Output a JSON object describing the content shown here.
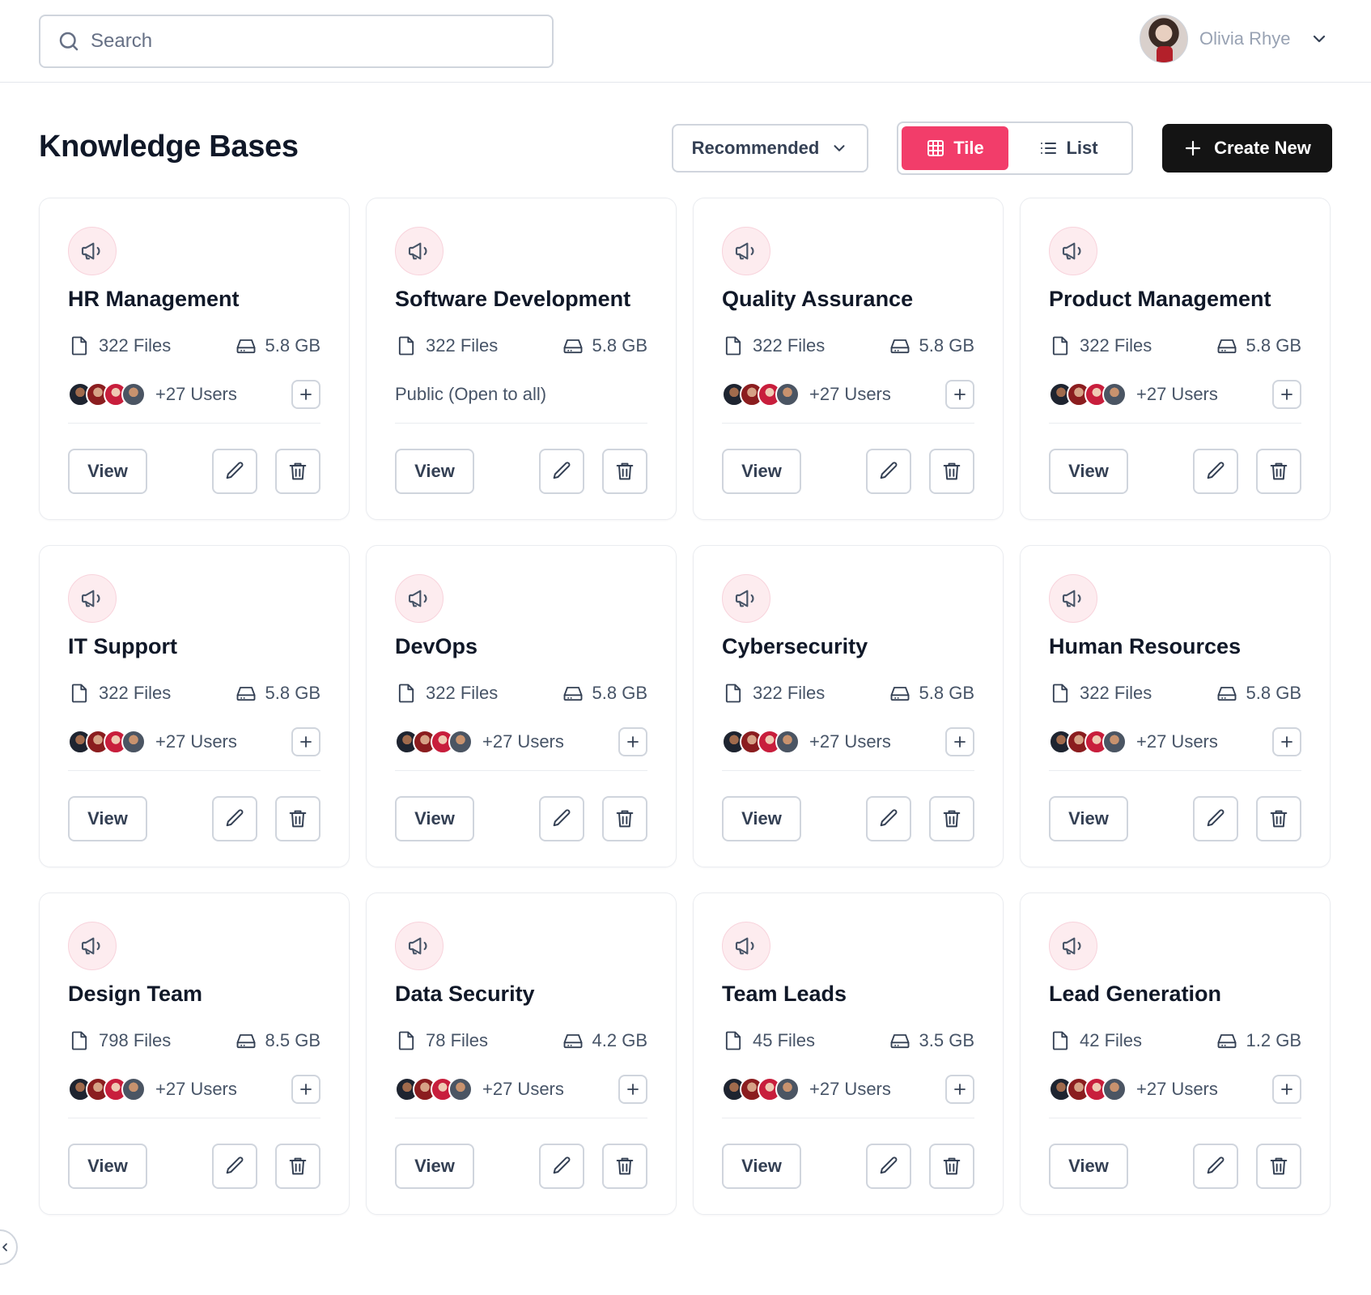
{
  "search": {
    "placeholder": "Search",
    "value": ""
  },
  "user": {
    "name": "Olivia Rhye"
  },
  "page": {
    "title": "Knowledge Bases"
  },
  "toolbar": {
    "sort_label": "Recommended",
    "view_tile_label": "Tile",
    "view_list_label": "List",
    "active_view": "Tile",
    "create_label": "Create New"
  },
  "colors": {
    "accent": "#f23d6a",
    "primary_dark": "#141414",
    "icon_bg": "#fdecef"
  },
  "icons": {
    "card": "megaphone-icon",
    "files": "file-icon",
    "size": "hard-drive-icon",
    "add_user": "plus-icon",
    "edit": "pencil-icon",
    "delete": "trash-icon"
  },
  "actions": {
    "view_label": "View"
  },
  "cards": [
    {
      "title": "HR Management",
      "files": "322 Files",
      "size": "5.8 GB",
      "users": "+27 Users"
    },
    {
      "title": "Software Development",
      "files": "322 Files",
      "size": "5.8 GB",
      "access": "Public (Open to all)"
    },
    {
      "title": "Quality Assurance",
      "files": "322 Files",
      "size": "5.8 GB",
      "users": "+27 Users"
    },
    {
      "title": "Product Management",
      "files": "322 Files",
      "size": "5.8 GB",
      "users": "+27 Users"
    },
    {
      "title": "IT Support",
      "files": "322 Files",
      "size": "5.8 GB",
      "users": "+27 Users"
    },
    {
      "title": "DevOps",
      "files": "322 Files",
      "size": "5.8 GB",
      "users": "+27 Users"
    },
    {
      "title": "Cybersecurity",
      "files": "322 Files",
      "size": "5.8 GB",
      "users": "+27 Users"
    },
    {
      "title": "Human Resources",
      "files": "322 Files",
      "size": "5.8 GB",
      "users": "+27 Users"
    },
    {
      "title": "Design Team",
      "files": "798 Files",
      "size": "8.5 GB",
      "users": "+27 Users"
    },
    {
      "title": "Data Security",
      "files": "78 Files",
      "size": "4.2 GB",
      "users": "+27 Users"
    },
    {
      "title": "Team Leads",
      "files": "45 Files",
      "size": "3.5 GB",
      "users": "+27 Users"
    },
    {
      "title": "Lead Generation",
      "files": "42 Files",
      "size": "1.2 GB",
      "users": "+27 Users"
    }
  ]
}
